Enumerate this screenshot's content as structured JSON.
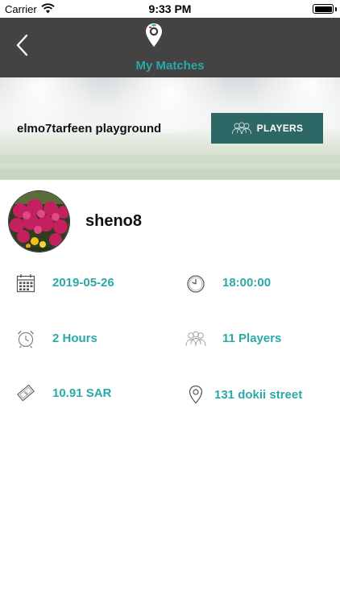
{
  "status_bar": {
    "carrier": "Carrier",
    "time": "9:33 PM"
  },
  "nav": {
    "title": "My Matches"
  },
  "banner": {
    "venue_name": "elmo7tarfeen playground",
    "players_button": "PLAYERS"
  },
  "profile": {
    "username": "sheno8"
  },
  "details": {
    "date": "2019-05-26",
    "time": "18:00:00",
    "duration": "2 Hours",
    "players": "11 Players",
    "price": "10.91 SAR",
    "address": "131 dokii street"
  },
  "colors": {
    "accent": "#2aa9a8",
    "nav_bar": "#434343",
    "players_button": "#2d6766"
  },
  "icons": [
    "chevron-left-icon",
    "map-pin-logo-icon",
    "players-icon",
    "calendar-icon",
    "clock-icon",
    "alarm-clock-icon",
    "group-icon",
    "money-icon",
    "location-pin-icon"
  ]
}
